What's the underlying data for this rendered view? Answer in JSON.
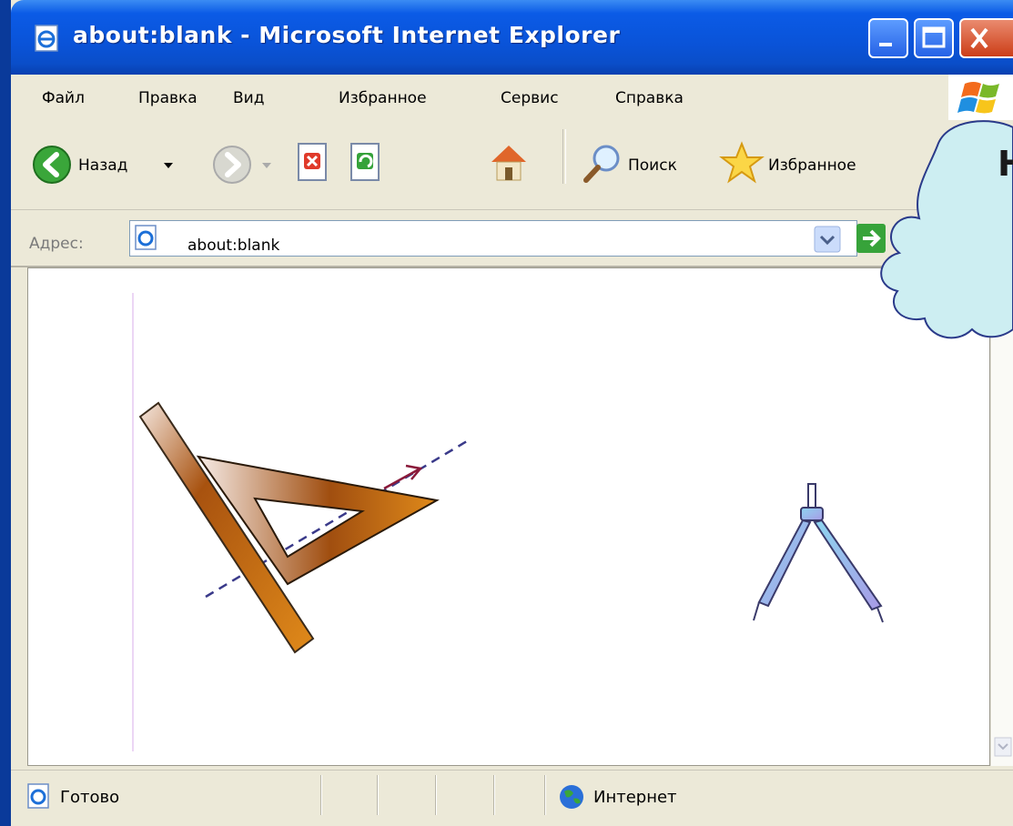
{
  "window": {
    "title": "about:blank - Microsoft Internet Explorer"
  },
  "menu": {
    "items": [
      "Файл",
      "Правка",
      "Вид",
      "Избранное",
      "Сервис",
      "Справка"
    ]
  },
  "toolbar": {
    "back_label": "Назад",
    "search_label": "Поиск",
    "favorites_label": "Избранное"
  },
  "address": {
    "label": "Адрес:",
    "value": "about:blank"
  },
  "status": {
    "text": "Готово",
    "zone": "Интернет"
  },
  "callout": {
    "text": "Н"
  },
  "colors": {
    "titlebar": "#0a53d8",
    "chrome": "#ece9d8",
    "ruler": "#b05a10",
    "compass": "#9a9ae6",
    "callout": "#cdeef2"
  }
}
